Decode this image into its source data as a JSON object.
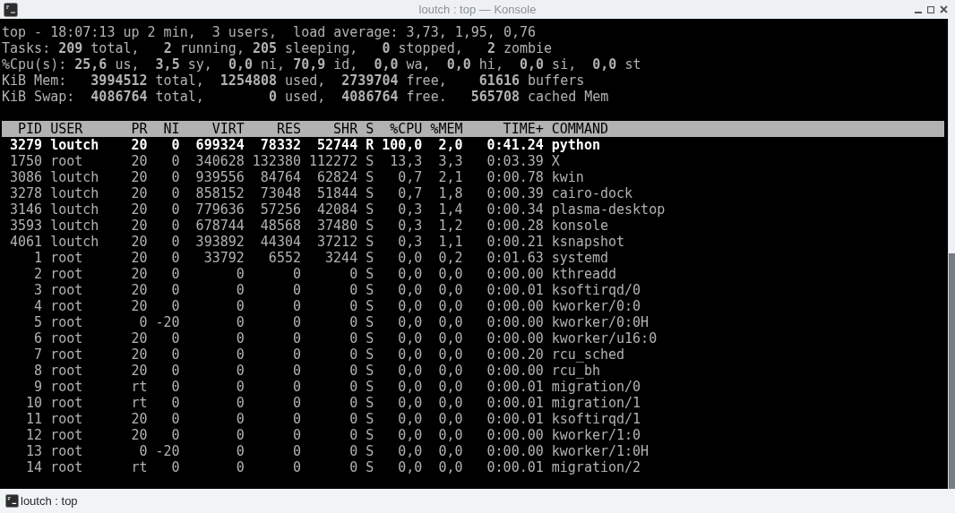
{
  "window": {
    "title": "loutch : top — Konsole"
  },
  "summary": [
    "top - 18:07:13 up 2 min,  3 users,  load average: 3,73, 1,95, 0,76",
    "Tasks: **209** total,   **2** running, **205** sleeping,   **0** stopped,   **2** zombie",
    "%Cpu(s): **25,6** us,  **3,5** sy,  **0,0** ni, **70,9** id,  **0,0** wa,  **0,0** hi,  **0,0** si,  **0,0** st",
    "KiB Mem:   **3994512** total,  **1254808** used,  **2739704** free,    **61616** buffers",
    "KiB Swap:  **4086764** total,        **0** used,  **4086764** free.   **565708** cached Mem"
  ],
  "table": {
    "columns": [
      "PID",
      "USER",
      "PR",
      "NI",
      "VIRT",
      "RES",
      "SHR",
      "S",
      "%CPU",
      "%MEM",
      "TIME+",
      "COMMAND"
    ],
    "rows": [
      {
        "highlighted": true,
        "cells": [
          "3279",
          "loutch",
          "20",
          "0",
          "699324",
          "78332",
          "52744",
          "R",
          "100,0",
          "2,0",
          "0:41.24",
          "python"
        ]
      },
      {
        "highlighted": false,
        "cells": [
          "1750",
          "root",
          "20",
          "0",
          "340628",
          "132380",
          "112272",
          "S",
          "13,3",
          "3,3",
          "0:03.39",
          "X"
        ]
      },
      {
        "highlighted": false,
        "cells": [
          "3086",
          "loutch",
          "20",
          "0",
          "939556",
          "84764",
          "62824",
          "S",
          "0,7",
          "2,1",
          "0:00.78",
          "kwin"
        ]
      },
      {
        "highlighted": false,
        "cells": [
          "3278",
          "loutch",
          "20",
          "0",
          "858152",
          "73048",
          "51844",
          "S",
          "0,7",
          "1,8",
          "0:00.39",
          "cairo-dock"
        ]
      },
      {
        "highlighted": false,
        "cells": [
          "3146",
          "loutch",
          "20",
          "0",
          "779636",
          "57256",
          "42084",
          "S",
          "0,3",
          "1,4",
          "0:00.34",
          "plasma-desktop"
        ]
      },
      {
        "highlighted": false,
        "cells": [
          "3593",
          "loutch",
          "20",
          "0",
          "678744",
          "48568",
          "37480",
          "S",
          "0,3",
          "1,2",
          "0:00.28",
          "konsole"
        ]
      },
      {
        "highlighted": false,
        "cells": [
          "4061",
          "loutch",
          "20",
          "0",
          "393892",
          "44304",
          "37212",
          "S",
          "0,3",
          "1,1",
          "0:00.21",
          "ksnapshot"
        ]
      },
      {
        "highlighted": false,
        "cells": [
          "1",
          "root",
          "20",
          "0",
          "33792",
          "6552",
          "3244",
          "S",
          "0,0",
          "0,2",
          "0:01.63",
          "systemd"
        ]
      },
      {
        "highlighted": false,
        "cells": [
          "2",
          "root",
          "20",
          "0",
          "0",
          "0",
          "0",
          "S",
          "0,0",
          "0,0",
          "0:00.00",
          "kthreadd"
        ]
      },
      {
        "highlighted": false,
        "cells": [
          "3",
          "root",
          "20",
          "0",
          "0",
          "0",
          "0",
          "S",
          "0,0",
          "0,0",
          "0:00.01",
          "ksoftirqd/0"
        ]
      },
      {
        "highlighted": false,
        "cells": [
          "4",
          "root",
          "20",
          "0",
          "0",
          "0",
          "0",
          "S",
          "0,0",
          "0,0",
          "0:00.00",
          "kworker/0:0"
        ]
      },
      {
        "highlighted": false,
        "cells": [
          "5",
          "root",
          "0",
          "-20",
          "0",
          "0",
          "0",
          "S",
          "0,0",
          "0,0",
          "0:00.00",
          "kworker/0:0H"
        ]
      },
      {
        "highlighted": false,
        "cells": [
          "6",
          "root",
          "20",
          "0",
          "0",
          "0",
          "0",
          "S",
          "0,0",
          "0,0",
          "0:00.00",
          "kworker/u16:0"
        ]
      },
      {
        "highlighted": false,
        "cells": [
          "7",
          "root",
          "20",
          "0",
          "0",
          "0",
          "0",
          "S",
          "0,0",
          "0,0",
          "0:00.20",
          "rcu_sched"
        ]
      },
      {
        "highlighted": false,
        "cells": [
          "8",
          "root",
          "20",
          "0",
          "0",
          "0",
          "0",
          "S",
          "0,0",
          "0,0",
          "0:00.00",
          "rcu_bh"
        ]
      },
      {
        "highlighted": false,
        "cells": [
          "9",
          "root",
          "rt",
          "0",
          "0",
          "0",
          "0",
          "S",
          "0,0",
          "0,0",
          "0:00.01",
          "migration/0"
        ]
      },
      {
        "highlighted": false,
        "cells": [
          "10",
          "root",
          "rt",
          "0",
          "0",
          "0",
          "0",
          "S",
          "0,0",
          "0,0",
          "0:00.01",
          "migration/1"
        ]
      },
      {
        "highlighted": false,
        "cells": [
          "11",
          "root",
          "20",
          "0",
          "0",
          "0",
          "0",
          "S",
          "0,0",
          "0,0",
          "0:00.01",
          "ksoftirqd/1"
        ]
      },
      {
        "highlighted": false,
        "cells": [
          "12",
          "root",
          "20",
          "0",
          "0",
          "0",
          "0",
          "S",
          "0,0",
          "0,0",
          "0:00.00",
          "kworker/1:0"
        ]
      },
      {
        "highlighted": false,
        "cells": [
          "13",
          "root",
          "0",
          "-20",
          "0",
          "0",
          "0",
          "S",
          "0,0",
          "0,0",
          "0:00.00",
          "kworker/1:0H"
        ]
      },
      {
        "highlighted": false,
        "cells": [
          "14",
          "root",
          "rt",
          "0",
          "0",
          "0",
          "0",
          "S",
          "0,0",
          "0,0",
          "0:00.01",
          "migration/2"
        ]
      }
    ]
  },
  "tab": {
    "label": "loutch : top"
  }
}
